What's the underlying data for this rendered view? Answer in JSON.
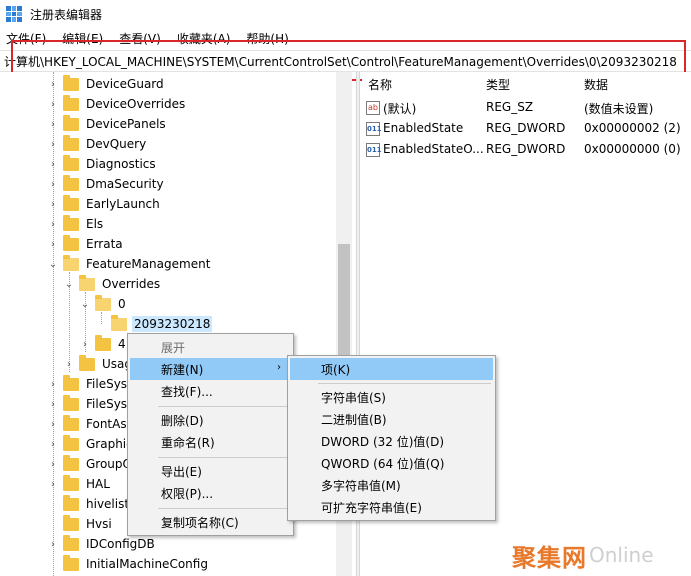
{
  "window": {
    "title": "注册表编辑器"
  },
  "menubar": {
    "items": [
      "文件(F)",
      "编辑(E)",
      "查看(V)",
      "收藏夹(A)",
      "帮助(H)"
    ]
  },
  "address": {
    "path": "计算机\\HKEY_LOCAL_MACHINE\\SYSTEM\\CurrentControlSet\\Control\\FeatureManagement\\Overrides\\0\\2093230218"
  },
  "tree": {
    "items": [
      {
        "label": "DeviceGuard",
        "expander": "›"
      },
      {
        "label": "DeviceOverrides",
        "expander": "›"
      },
      {
        "label": "DevicePanels",
        "expander": "›"
      },
      {
        "label": "DevQuery",
        "expander": "›"
      },
      {
        "label": "Diagnostics",
        "expander": "›"
      },
      {
        "label": "DmaSecurity",
        "expander": "›"
      },
      {
        "label": "EarlyLaunch",
        "expander": "›"
      },
      {
        "label": "Els",
        "expander": "›"
      },
      {
        "label": "Errata",
        "expander": "›"
      },
      {
        "label": "FeatureManagement",
        "expander": "⌄"
      },
      {
        "label": "Overrides",
        "expander": "⌄"
      },
      {
        "label": "0",
        "expander": "⌄"
      },
      {
        "label": "2093230218",
        "expander": ""
      },
      {
        "label": "4",
        "expander": "›"
      },
      {
        "label": "Usag",
        "expander": "›"
      },
      {
        "label": "FileSyste",
        "expander": "›"
      },
      {
        "label": "FileSyste",
        "expander": "›"
      },
      {
        "label": "FontAss",
        "expander": "›"
      },
      {
        "label": "Graphic",
        "expander": "›"
      },
      {
        "label": "GroupO",
        "expander": "›"
      },
      {
        "label": "HAL",
        "expander": "›"
      },
      {
        "label": "hivelist",
        "expander": ""
      },
      {
        "label": "Hvsi",
        "expander": ""
      },
      {
        "label": "IDConfigDB",
        "expander": "›"
      },
      {
        "label": "InitialMachineConfig",
        "expander": ""
      }
    ]
  },
  "list": {
    "headers": {
      "name": "名称",
      "type": "类型",
      "data": "数据"
    },
    "rows": [
      {
        "icon": "ab",
        "name": "(默认)",
        "type": "REG_SZ",
        "data": "(数值未设置)"
      },
      {
        "icon": "011",
        "name": "EnabledState",
        "type": "REG_DWORD",
        "data": "0x00000002 (2)"
      },
      {
        "icon": "011",
        "name": "EnabledStateO...",
        "type": "REG_DWORD",
        "data": "0x00000000 (0)"
      }
    ]
  },
  "context_menu": {
    "items": [
      "展开",
      "新建(N)",
      "查找(F)...",
      "删除(D)",
      "重命名(R)",
      "导出(E)",
      "权限(P)...",
      "复制项名称(C)"
    ],
    "arrow": "›"
  },
  "submenu": {
    "items": [
      "项(K)",
      "字符串值(S)",
      "二进制值(B)",
      "DWORD (32 位)值(D)",
      "QWORD (64 位)值(Q)",
      "多字符串值(M)",
      "可扩充字符串值(E)"
    ]
  },
  "watermark": {
    "cn": "聚集网",
    "en": "Online"
  },
  "colors": {
    "highlight": "#91c9f7",
    "selection": "#cce8ff",
    "frame": "#d9262b",
    "folder": "#f5c342"
  }
}
